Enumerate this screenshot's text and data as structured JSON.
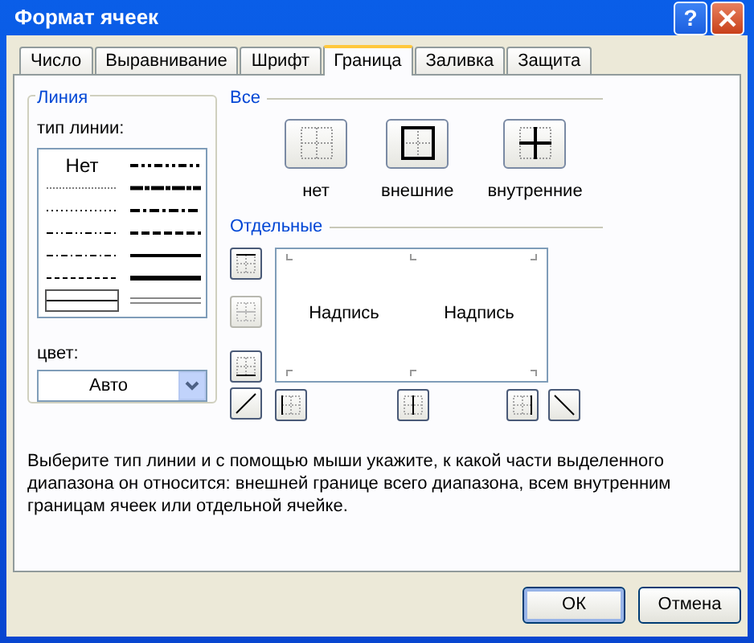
{
  "window": {
    "title": "Формат ячеек",
    "help_button": "?"
  },
  "tabs": [
    {
      "label": "Число",
      "selected": false
    },
    {
      "label": "Выравнивание",
      "selected": false
    },
    {
      "label": "Шрифт",
      "selected": false
    },
    {
      "label": "Граница",
      "selected": true
    },
    {
      "label": "Заливка",
      "selected": false
    },
    {
      "label": "Защита",
      "selected": false
    }
  ],
  "line": {
    "title": "Линия",
    "style_label": "тип линии:",
    "styles": [
      {
        "kind": "none",
        "label": "Нет",
        "selected": false
      },
      {
        "kind": "hair",
        "selected": false
      },
      {
        "kind": "dotted",
        "selected": false
      },
      {
        "kind": "dashdotdot",
        "selected": false
      },
      {
        "kind": "dashdot",
        "selected": false
      },
      {
        "kind": "dashed",
        "selected": false
      },
      {
        "kind": "thin",
        "selected": true
      },
      {
        "kind": "mediumdashdotdot",
        "selected": false
      },
      {
        "kind": "slantdashdot",
        "selected": false
      },
      {
        "kind": "mediumdashdot",
        "selected": false
      },
      {
        "kind": "mediumdashed",
        "selected": false
      },
      {
        "kind": "medium",
        "selected": false
      },
      {
        "kind": "thick",
        "selected": false
      },
      {
        "kind": "double",
        "selected": false
      }
    ],
    "color_label": "цвет:",
    "color_value": "Авто"
  },
  "presets": {
    "title": "Все",
    "items": [
      {
        "kind": "none",
        "label": "нет"
      },
      {
        "kind": "outline",
        "label": "внешние"
      },
      {
        "kind": "inside",
        "label": "внутренние"
      }
    ]
  },
  "borders": {
    "title": "Отдельные",
    "side_buttons": [
      {
        "kind": "top",
        "disabled": false
      },
      {
        "kind": "middle-h",
        "disabled": true
      },
      {
        "kind": "bottom",
        "disabled": false
      },
      {
        "kind": "diag-up",
        "disabled": false
      }
    ],
    "bottom_buttons": [
      {
        "kind": "left",
        "disabled": false
      },
      {
        "kind": "middle-v",
        "disabled": false
      },
      {
        "kind": "right",
        "disabled": false
      },
      {
        "kind": "diag-down",
        "disabled": false
      }
    ],
    "preview_texts": [
      "Надпись",
      "Надпись"
    ]
  },
  "help_text": "Выберите тип линии и с помощью мыши укажите, к какой части выделенного диапазона он относится: внешней границе всего диапазона, всем внутренним границам ячеек или отдельной ячейке.",
  "buttons": [
    {
      "label": "ОК",
      "default": true
    },
    {
      "label": "Отмена",
      "default": false
    }
  ]
}
